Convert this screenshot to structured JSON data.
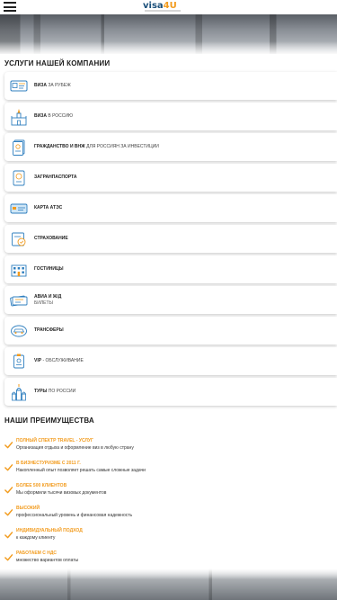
{
  "header": {
    "logo_main": "visa",
    "logo_accent": "4U"
  },
  "services_title": "УСЛУГИ НАШЕЙ КОМПАНИИ",
  "services": [
    {
      "bold": "ВИЗА",
      "rest": " ЗА РУБЕЖ",
      "sub": "",
      "icon": "passport-visa-icon"
    },
    {
      "bold": "ВИЗА",
      "rest": " В РОССИЮ",
      "sub": "",
      "icon": "kremlin-icon"
    },
    {
      "bold": "ГРАЖДАНСТВО И ВНЖ",
      "rest": " ДЛЯ РОССИЯН ЗА ИНВЕСТИЦИИ",
      "sub": "",
      "icon": "citizenship-document-icon"
    },
    {
      "bold": "ЗАГРАНПАСПОРТА",
      "rest": "",
      "sub": "",
      "icon": "passport-icon"
    },
    {
      "bold": "КАРТА АТЭС",
      "rest": "",
      "sub": "",
      "icon": "card-icon"
    },
    {
      "bold": "СТРАХОВАНИЕ",
      "rest": "",
      "sub": "",
      "icon": "insurance-icon"
    },
    {
      "bold": "ГОСТИНИЦЫ",
      "rest": "",
      "sub": "",
      "icon": "hotel-icon"
    },
    {
      "bold": "АВИА И Ж/Д",
      "rest": "",
      "sub": "БИЛЕТЫ",
      "icon": "tickets-icon"
    },
    {
      "bold": "ТРАНСФЕРЫ",
      "rest": "",
      "sub": "",
      "icon": "car-transfer-icon"
    },
    {
      "bold": "VIP",
      "rest": " - ОБСЛУЖИВАНИЕ",
      "sub": "",
      "icon": "vip-badge-icon"
    },
    {
      "bold": "ТУРЫ",
      "rest": " ПО РОССИИ",
      "sub": "",
      "icon": "church-icon"
    }
  ],
  "advantages_title": "НАШИ ПРЕИМУЩЕСТВА",
  "advantages": [
    {
      "title": "ПОЛНЫЙ СПЕКТР TRAVEL - УСЛУГ",
      "desc": "Организация отдыха и оформление виз в любую страну"
    },
    {
      "title": "В БИЗНЕСТУРИЗМЕ С 2011 Г.",
      "desc": "Накопленный опыт позволяет решать самые сложные задачи"
    },
    {
      "title": "БОЛЕЕ 500 КЛИЕНТОВ",
      "desc": "Мы оформили тысячи визовых документов"
    },
    {
      "title": "ВЫСОКИЙ",
      "desc": "профессиональный уровень и финансовая надежность"
    },
    {
      "title": "ИНДИВИДУАЛЬНЫЙ ПОДХОД",
      "desc": "к каждому клиенту"
    },
    {
      "title": "РАБОТАЕМ С НДС",
      "desc": "множество вариантов оплаты"
    }
  ],
  "colors": {
    "accent": "#f29b1d",
    "brand": "#1a4f7a"
  }
}
